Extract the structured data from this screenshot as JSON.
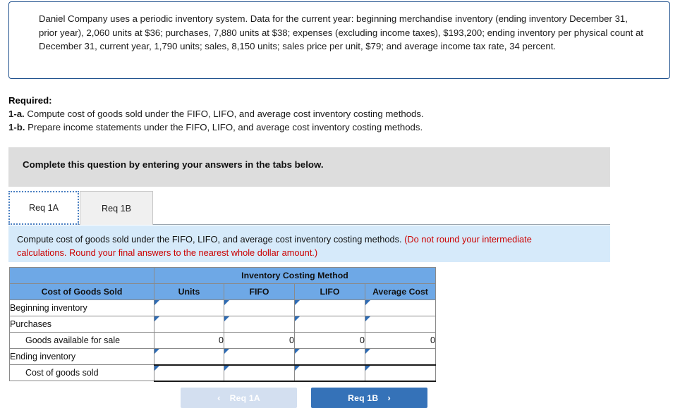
{
  "problem": {
    "text": "Daniel Company uses a periodic inventory system. Data for the current year: beginning merchandise inventory (ending inventory December 31, prior year), 2,060 units at $36; purchases, 7,880 units at $38; expenses (excluding income taxes), $193,200; ending inventory per physical count at December 31, current year, 1,790 units; sales, 8,150 units; sales price per unit, $79; and average income tax rate, 34 percent."
  },
  "required": {
    "heading": "Required:",
    "items": [
      {
        "label": "1-a.",
        "text": "Compute cost of goods sold under the FIFO, LIFO, and average cost inventory costing methods."
      },
      {
        "label": "1-b.",
        "text": "Prepare income statements under the FIFO, LIFO, and average cost inventory costing methods."
      }
    ]
  },
  "banner": {
    "text": "Complete this question by entering your answers in the tabs below."
  },
  "tabs": [
    {
      "label": "Req 1A",
      "active": true
    },
    {
      "label": "Req 1B",
      "active": false
    }
  ],
  "instruction": {
    "main": "Compute cost of goods sold under the FIFO, LIFO, and average cost inventory costing methods.",
    "note": "(Do not round your intermediate calculations. Round your final answers to the nearest whole dollar amount.)"
  },
  "table": {
    "group_header": "Inventory Costing Method",
    "columns": [
      "Cost of Goods Sold",
      "Units",
      "FIFO",
      "LIFO",
      "Average Cost"
    ],
    "rows": [
      {
        "label": "Beginning inventory",
        "indent": false,
        "type": "input",
        "values": [
          "",
          "",
          "",
          ""
        ]
      },
      {
        "label": "Purchases",
        "indent": false,
        "type": "input",
        "values": [
          "",
          "",
          "",
          ""
        ]
      },
      {
        "label": "Goods available for sale",
        "indent": true,
        "type": "calc",
        "values": [
          "0",
          "0",
          "0",
          "0"
        ]
      },
      {
        "label": "Ending inventory",
        "indent": false,
        "type": "input",
        "values": [
          "",
          "",
          "",
          ""
        ]
      },
      {
        "label": "Cost of goods sold",
        "indent": true,
        "type": "input",
        "values": [
          "",
          "",
          "",
          ""
        ]
      }
    ]
  },
  "nav": {
    "prev_label": "Req 1A",
    "prev_icon": "chevron-left",
    "next_label": "Req 1B",
    "next_icon": "chevron-right"
  },
  "colors": {
    "header_blue": "#6ea8e6",
    "instruction_bg": "#d6eafa",
    "banner_gray": "#dddddd",
    "accent_blue": "#3572b8",
    "disabled_blue": "#d3dff0",
    "note_red": "#cc0000",
    "box_border": "#1d4f8c"
  }
}
